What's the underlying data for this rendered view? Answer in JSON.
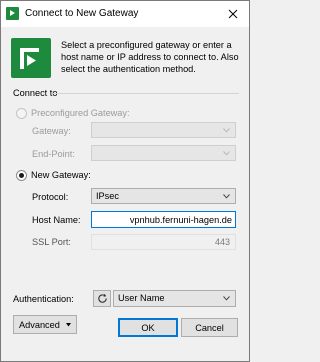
{
  "window": {
    "title": "Connect to New Gateway"
  },
  "intro": {
    "text": "Select a preconfigured gateway or enter a host name or IP address to connect to. Also select the authentication method."
  },
  "connect_to": {
    "section_label": "Connect to",
    "preconfigured": {
      "label": "Preconfigured Gateway:",
      "selected": false,
      "enabled": false,
      "gateway_label": "Gateway:",
      "gateway_value": "",
      "endpoint_label": "End-Point:",
      "endpoint_value": ""
    },
    "new_gateway": {
      "label": "New Gateway:",
      "selected": true,
      "protocol_label": "Protocol:",
      "protocol_value": "IPsec",
      "host_label": "Host Name:",
      "host_value": "vpnhub.fernuni-hagen.de",
      "ssl_port_label": "SSL Port:",
      "ssl_port_value": "443"
    }
  },
  "authentication": {
    "label": "Authentication:",
    "value": "User Name"
  },
  "buttons": {
    "advanced": "Advanced",
    "ok": "OK",
    "cancel": "Cancel"
  },
  "colors": {
    "brand_green": "#1e8a3e",
    "focus_blue": "#0078d7"
  },
  "icons": {
    "title_app": "app-logo-icon",
    "big": "gateway-logo-icon",
    "close": "close-icon",
    "dropdown": "chevron-down-icon",
    "refresh": "refresh-icon"
  }
}
